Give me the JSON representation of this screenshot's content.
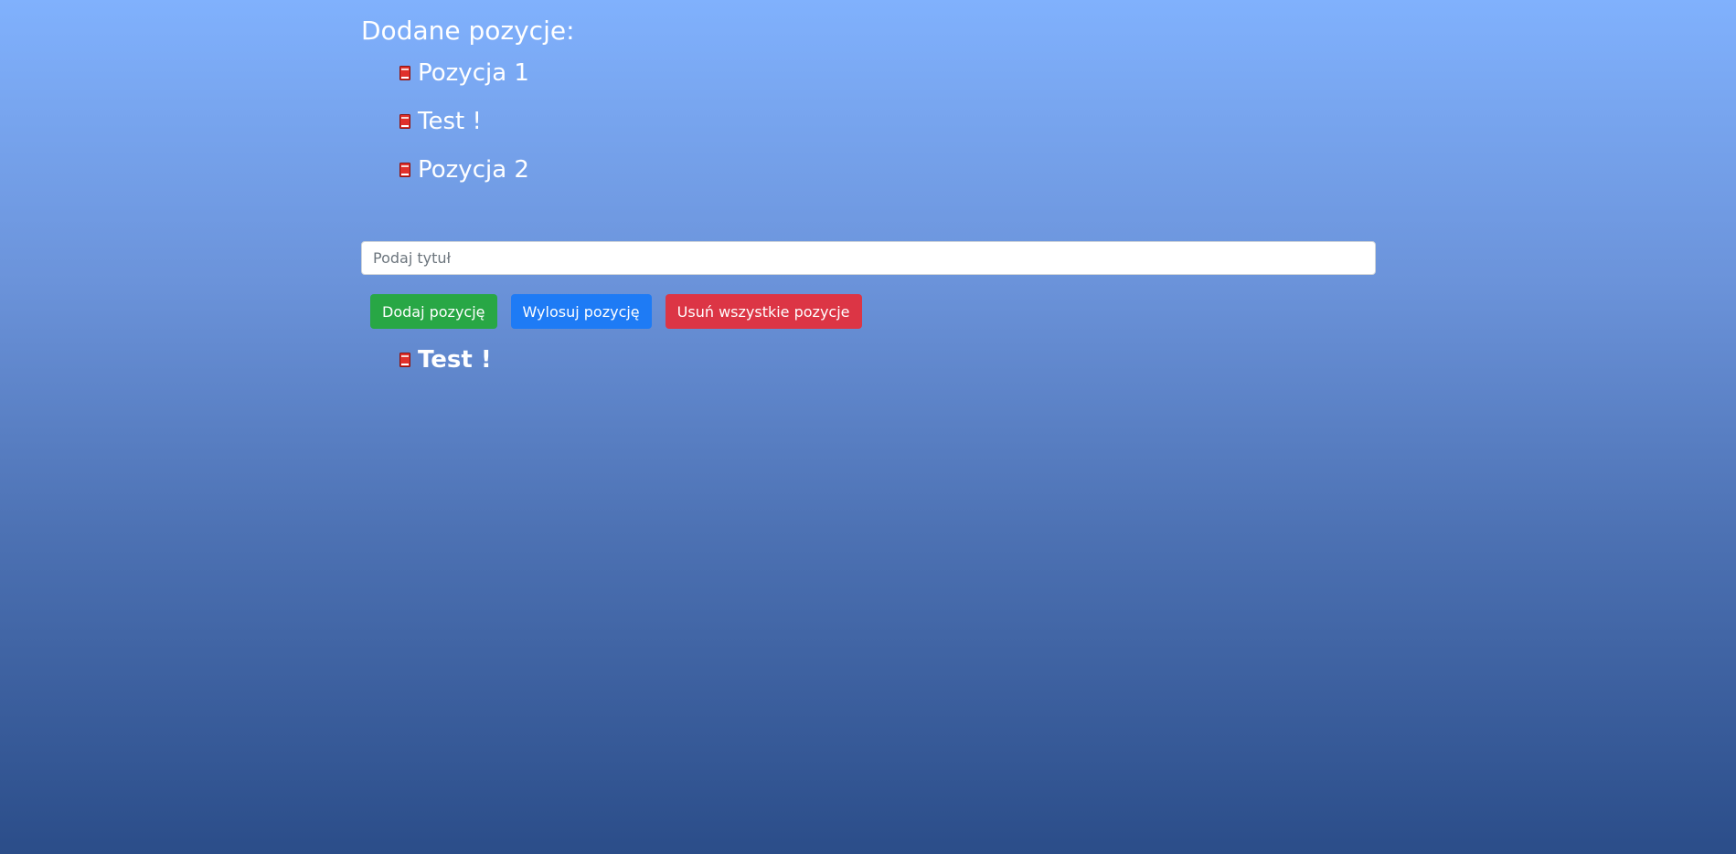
{
  "list": {
    "heading": "Dodane pozycje:",
    "items": [
      {
        "label": "Pozycja 1",
        "icon": "book-icon"
      },
      {
        "label": "Test !",
        "icon": "book-icon"
      },
      {
        "label": "Pozycja 2",
        "icon": "book-icon"
      }
    ]
  },
  "form": {
    "title_placeholder": "Podaj tytuł",
    "title_value": ""
  },
  "actions": {
    "add_label": "Dodaj pozycję",
    "draw_label": "Wylosuj pozycję",
    "clear_label": "Usuń wszystkie pozycje"
  },
  "result": {
    "label": "Test !",
    "icon": "book-icon"
  },
  "colors": {
    "add": "#28a745",
    "draw": "#1e7bf5",
    "clear": "#dc3545",
    "book": "#e0302b"
  }
}
